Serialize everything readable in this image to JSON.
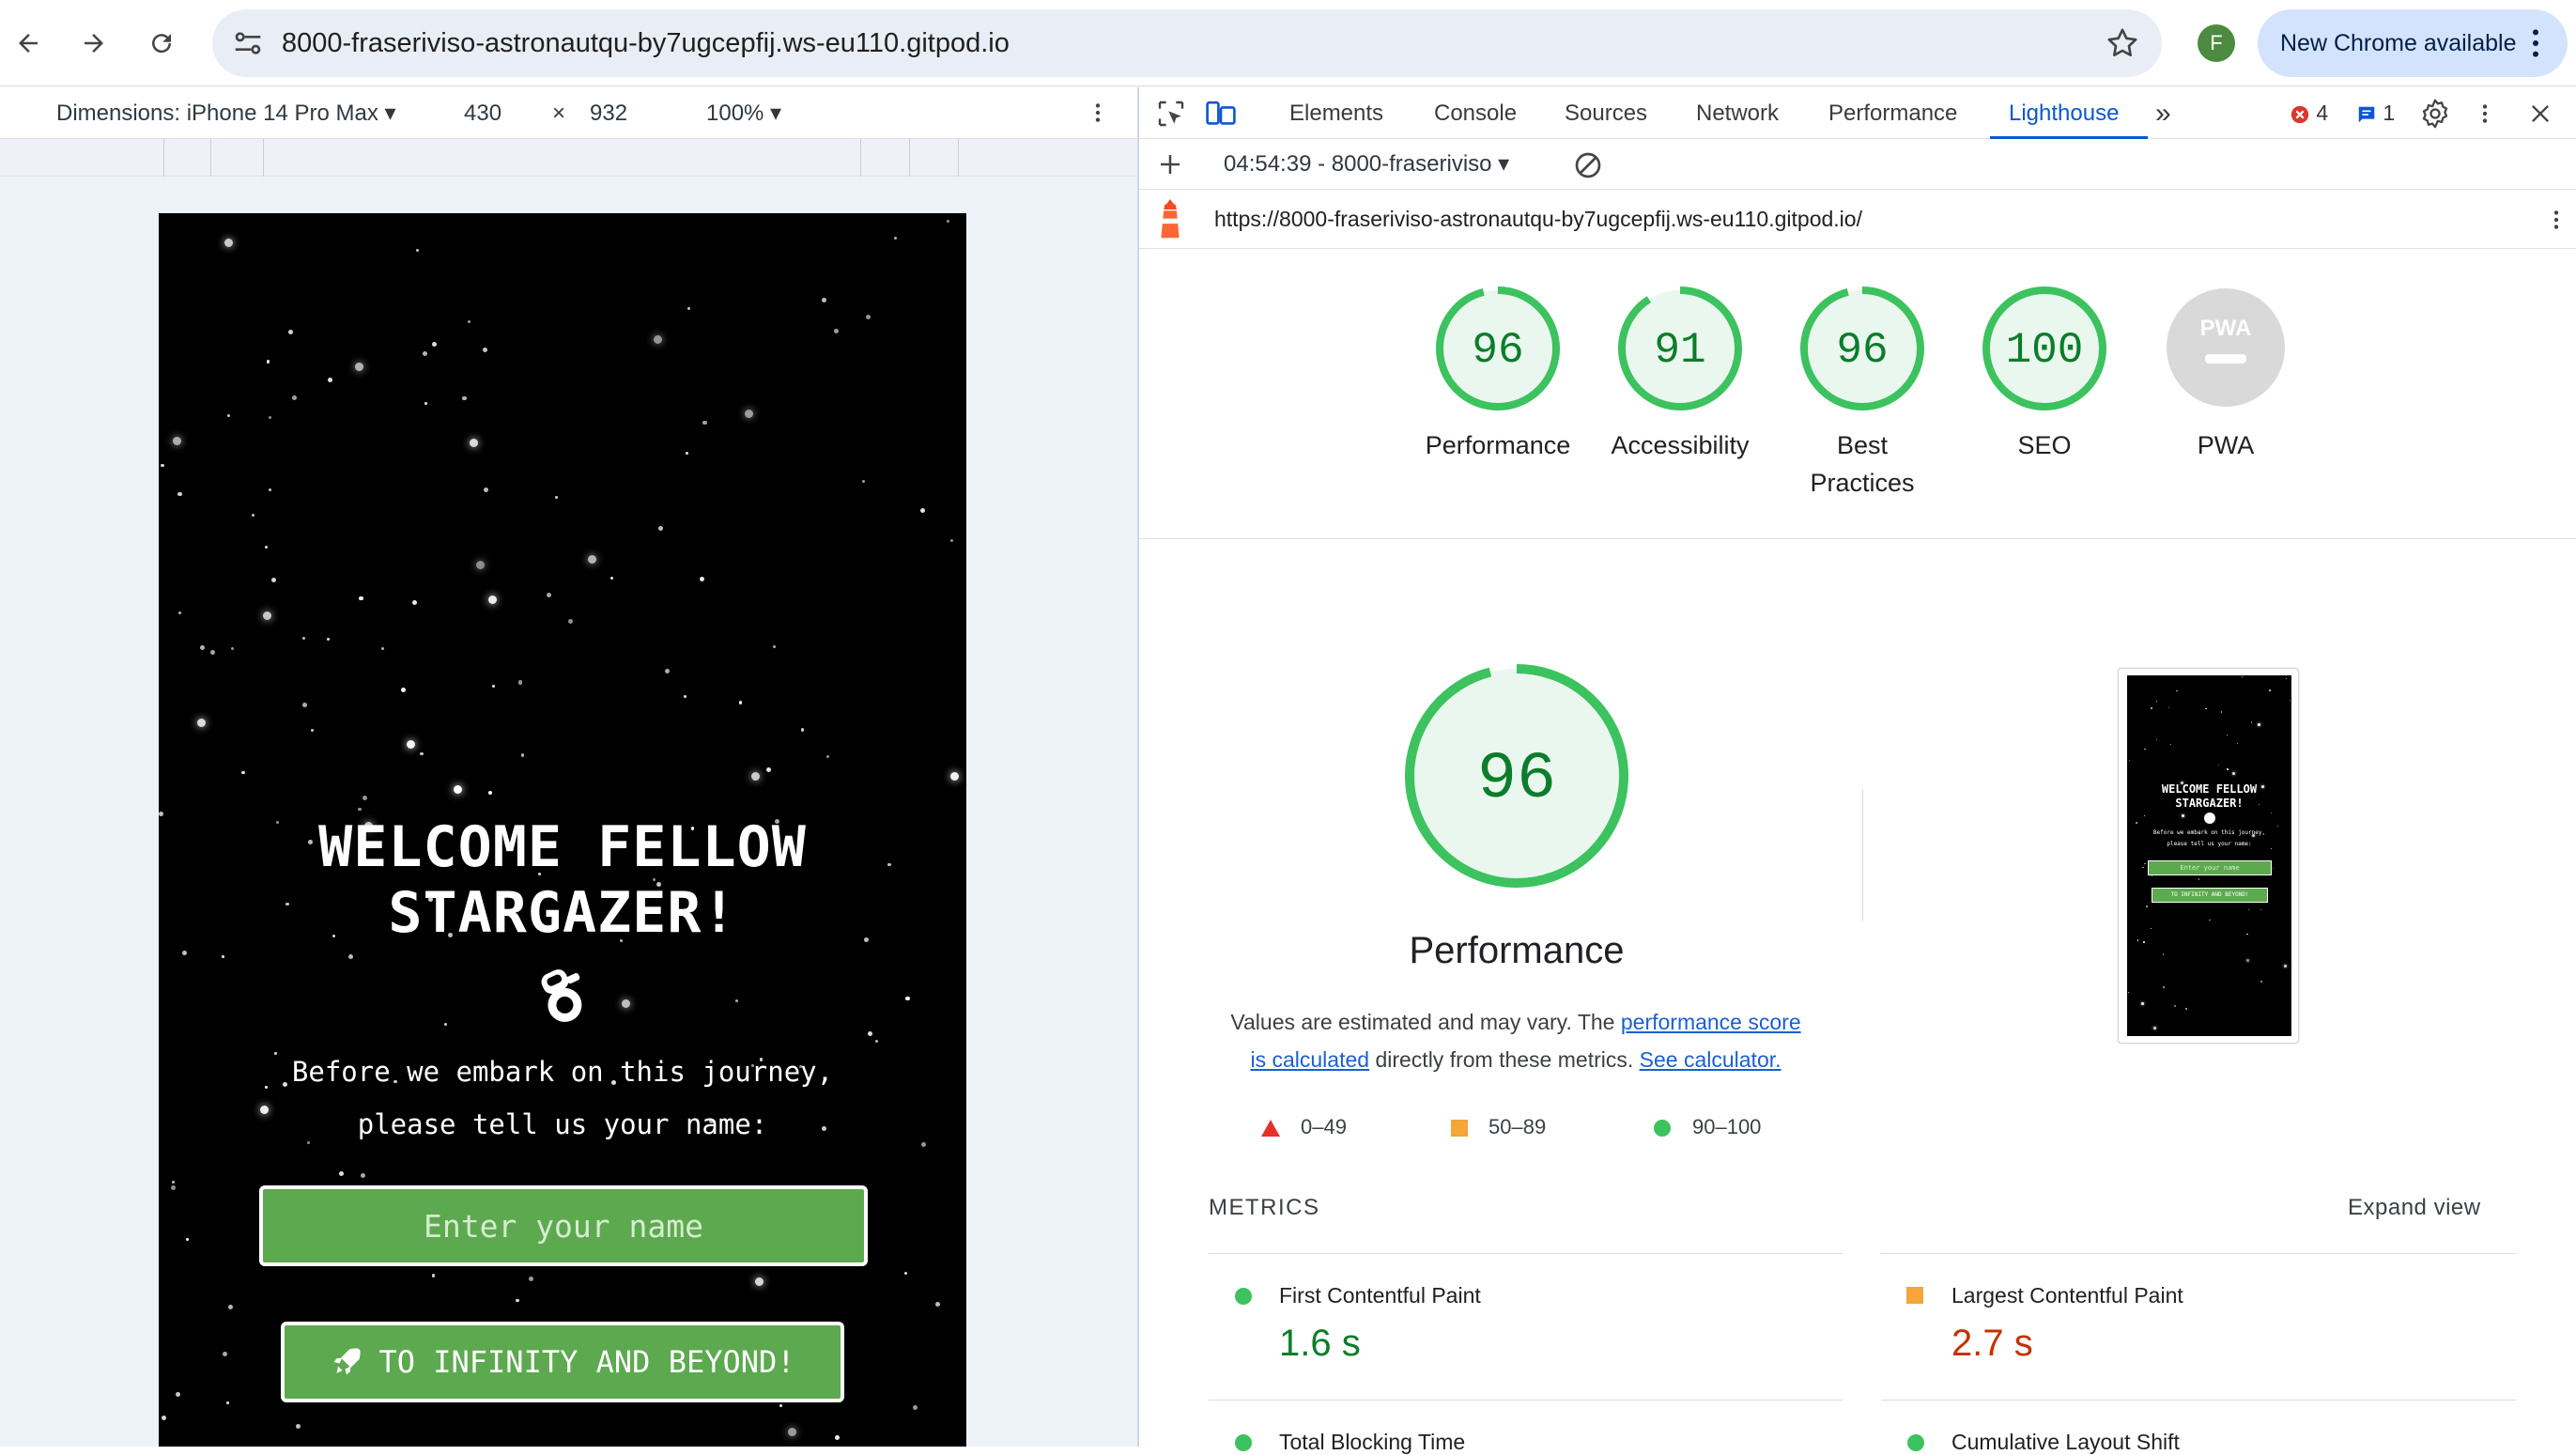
{
  "browser": {
    "url": "8000-fraseriviso-astronautqu-by7ugcepfij.ws-eu110.gitpod.io",
    "profile_initial": "F",
    "new_chrome_label": "New Chrome available"
  },
  "device_toolbar": {
    "dimensions_label": "Dimensions: iPhone 14 Pro Max",
    "width": "430",
    "times": "×",
    "height": "932",
    "zoom": "100%"
  },
  "page": {
    "heading_line1": "WELCOME FELLOW",
    "heading_line2": "STARGAZER!",
    "prompt_line1": "Before we embark on this journey,",
    "prompt_line2": "please tell us your name:",
    "input_placeholder": "Enter your name",
    "button_label": "TO INFINITY AND BEYOND!"
  },
  "devtools": {
    "tabs": [
      "Elements",
      "Console",
      "Sources",
      "Network",
      "Performance",
      "Lighthouse"
    ],
    "more_tabs": "»",
    "error_count": "4",
    "message_count": "1",
    "report_select": "04:54:39 - 8000-fraseriviso",
    "report_url": "https://8000-fraseriviso-astronautqu-by7ugcepfij.ws-eu110.gitpod.io/"
  },
  "lighthouse": {
    "scores": [
      {
        "value": "96",
        "score": 0.96,
        "label_line1": "Performance",
        "label_line2": ""
      },
      {
        "value": "91",
        "score": 0.91,
        "label_line1": "Accessibility",
        "label_line2": ""
      },
      {
        "value": "96",
        "score": 0.96,
        "label_line1": "Best",
        "label_line2": "Practices"
      },
      {
        "value": "100",
        "score": 1.0,
        "label_line1": "SEO",
        "label_line2": ""
      }
    ],
    "pwa_badge_text": "PWA",
    "pwa_label": "PWA",
    "main_score": {
      "value": "96",
      "score": 0.96
    },
    "section_title": "Performance",
    "desc_before": "Values are estimated and may vary. The ",
    "desc_link1a": "performance score",
    "desc_link1b": "is calculated",
    "desc_middle": " directly from these metrics. ",
    "desc_link2": "See calculator.",
    "legend": {
      "fail": "0–49",
      "average": "50–89",
      "pass": "90–100"
    },
    "thumbnail_text": {
      "line1": "WELCOME FELLOW",
      "line2": "STARGAZER!",
      "line3": "Before we embark on this journey,",
      "line4": "please tell us your name:",
      "input": "Enter your name",
      "button": "TO INFINITY AND BEYOND!"
    },
    "metrics_label": "METRICS",
    "expand_view": "Expand view",
    "metrics": [
      {
        "name": "First Contentful Paint",
        "value": "1.6 s",
        "status": "pass"
      },
      {
        "name": "Largest Contentful Paint",
        "value": "2.7 s",
        "status": "average"
      },
      {
        "name": "Total Blocking Time",
        "value": "",
        "status": "pass"
      },
      {
        "name": "Cumulative Layout Shift",
        "value": "",
        "status": "pass"
      }
    ],
    "colors": {
      "pass": "#0c9d32",
      "pass_ring": "#3cc25e",
      "pass_fill": "#eaf7ee",
      "average": "#c33300",
      "average_dot": "#f5a539",
      "fail": "#e5312c"
    }
  }
}
